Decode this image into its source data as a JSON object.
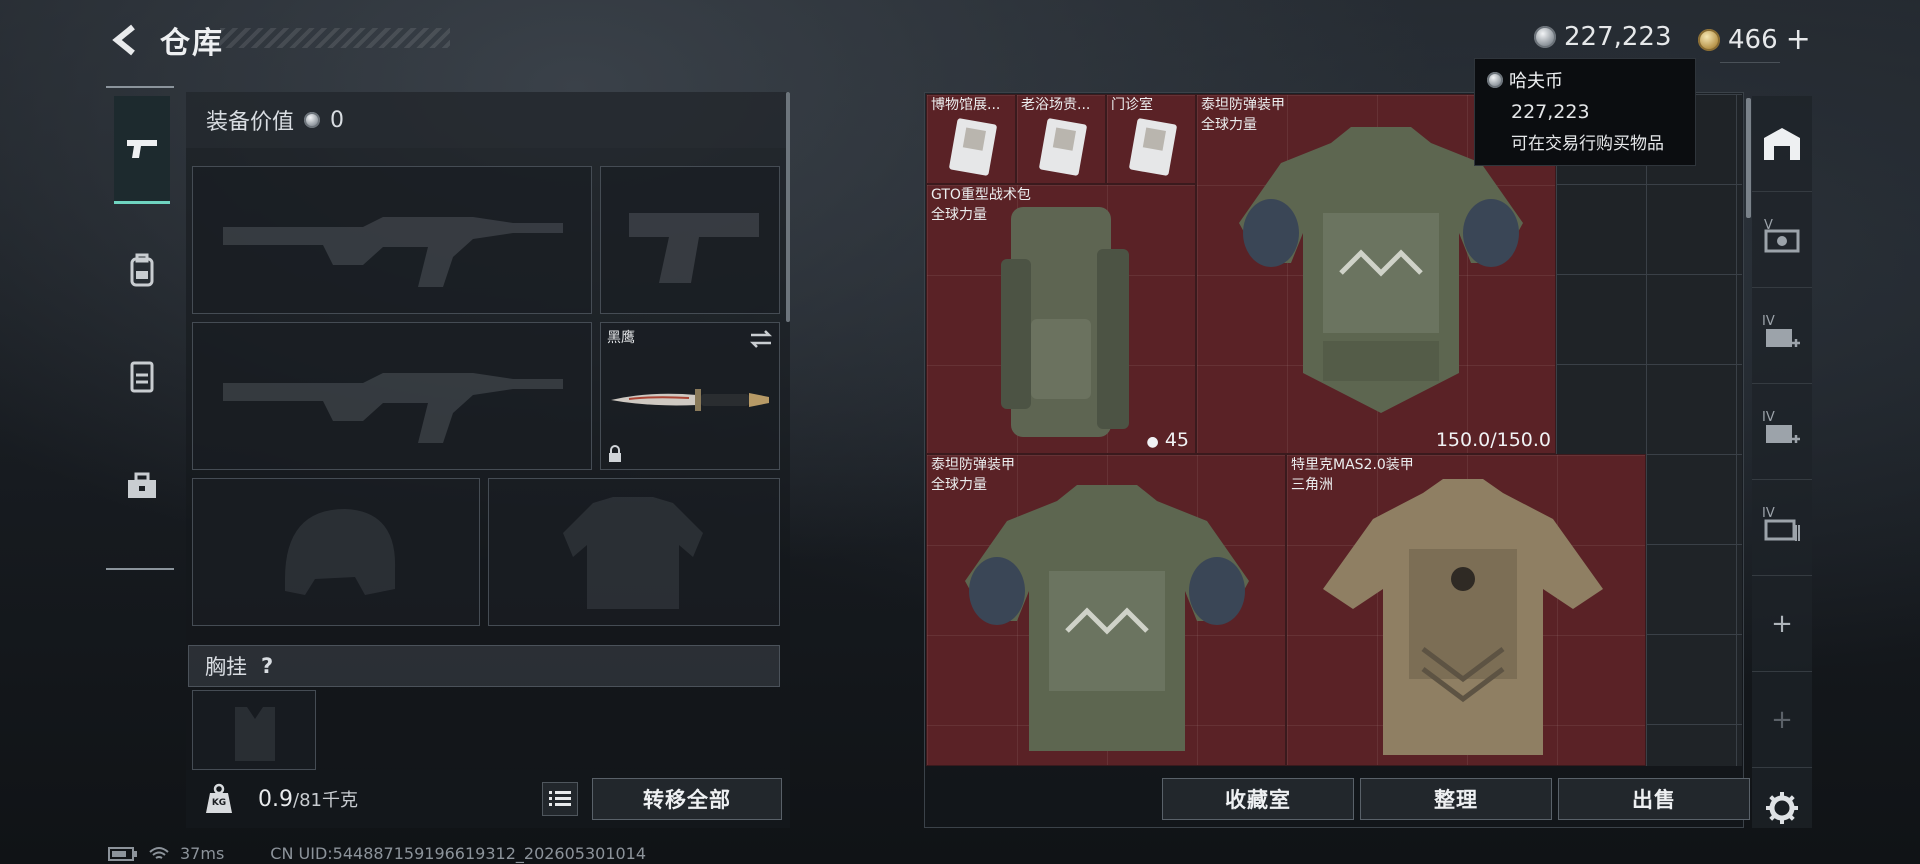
{
  "header": {
    "title": "仓库",
    "currency_silver": "227,223",
    "currency_gold": "466",
    "currency_gold_plus": "+"
  },
  "left_rail": {
    "tabs": [
      {
        "icon": "pistol-icon",
        "active": true
      },
      {
        "icon": "backpack-icon"
      },
      {
        "icon": "vest-icon"
      },
      {
        "icon": "toolbox-icon"
      }
    ]
  },
  "equipment": {
    "value_label": "装备价值",
    "value_amount": "0",
    "melee_slot_label": "黑鹰",
    "chest_rig_label": "胸挂",
    "help_mark": "?",
    "weight_current": "0.9",
    "weight_max": "/81千克",
    "weight_icon_text": "KG",
    "transfer_all_label": "转移全部"
  },
  "stash": {
    "items": [
      {
        "name": "博物馆展...",
        "sub": ""
      },
      {
        "name": "老浴场贵...",
        "sub": ""
      },
      {
        "name": "门诊室",
        "sub": ""
      },
      {
        "name": "泰坦防弹装甲",
        "sub": "全球力量",
        "stat": "150.0/150.0"
      },
      {
        "name": "GTO重型战术包",
        "sub": "全球力量",
        "stat": "45"
      },
      {
        "name": "泰坦防弹装甲",
        "sub": "全球力量"
      },
      {
        "name": "特里克MAS2.0装甲",
        "sub": "三角洲"
      }
    ],
    "buttons": {
      "collection": "收藏室",
      "sort": "整理",
      "sell": "出售"
    }
  },
  "right_rail": {
    "labels": [
      "V",
      "IV",
      "IV",
      "IV",
      "+",
      "+"
    ]
  },
  "tooltip": {
    "title": "哈夫币",
    "amount": "227,223",
    "description": "可在交易行购买物品"
  },
  "status_bar": {
    "ping": "37ms",
    "uid": "CN UID:544887159196619312_202605301014"
  },
  "colors": {
    "accent_teal": "#6fd4c0",
    "item_red": "#5a2226"
  }
}
